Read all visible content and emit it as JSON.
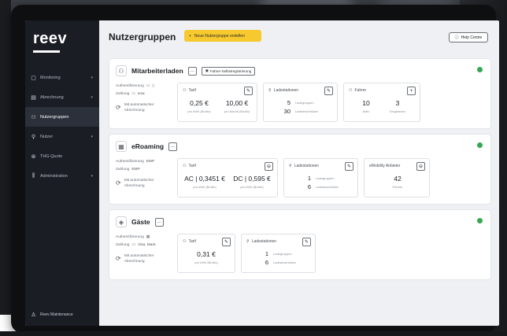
{
  "app": {
    "logo": "reev",
    "page_title": "Nutzergruppen",
    "create_button": "Neue Nutzergruppe erstellen",
    "help_button": "Help Centre"
  },
  "sidebar": {
    "items": [
      {
        "label": "Monitoring",
        "icon": "monitor-icon",
        "has_chevron": true
      },
      {
        "label": "Abrechnung",
        "icon": "billing-icon",
        "has_chevron": true
      },
      {
        "label": "Nutzergruppen",
        "icon": "users-icon",
        "has_chevron": false,
        "active": true
      },
      {
        "label": "Nutzer",
        "icon": "user-icon",
        "has_chevron": true
      },
      {
        "label": "THG Quote",
        "icon": "co2-icon",
        "has_chevron": false
      },
      {
        "label": "Administration",
        "icon": "admin-icon",
        "has_chevron": true
      }
    ],
    "user": "Reev Maintenance"
  },
  "groups": [
    {
      "name": "Mitarbeiterladen",
      "extra_button": "Fahrer-Selbstregistrierung",
      "auth_label": "Authentifizierung",
      "payment_label": "Zahlung",
      "payment_value": "sow.",
      "billing": "Mit automatischer Abrechnung",
      "tariff": {
        "title": "Tarif",
        "values": [
          {
            "v": "0,25 €",
            "l": "pro kWh (Brutto)"
          },
          {
            "v": "10,00 €",
            "l": "pro Monat (Brutto)"
          }
        ]
      },
      "stations": {
        "title": "Ladestationen",
        "rows": [
          {
            "n": "5",
            "l": "Ladegruppen"
          },
          {
            "n": "30",
            "l": "Ladeanschlüsse"
          }
        ]
      },
      "drivers": {
        "title": "Fahrer",
        "values": [
          {
            "v": "10",
            "l": "Aktiv"
          },
          {
            "v": "3",
            "l": "Eingeladen"
          }
        ]
      }
    },
    {
      "name": "eRoaming",
      "auth_label": "Authentifizierung",
      "auth_value": "EMP",
      "payment_label": "Zahlung",
      "payment_value": "EMP",
      "billing": "Mit automatischer Abrechnung",
      "tariff": {
        "title": "Tarif",
        "values": [
          {
            "v": "AC | 0,3451 €",
            "l": "pro kWh (Brutto)"
          },
          {
            "v": "DC | 0,595 €",
            "l": "pro kWh (Brutto)"
          }
        ]
      },
      "stations": {
        "title": "Ladestationen",
        "rows": [
          {
            "n": "1",
            "l": "Ladegruppen"
          },
          {
            "n": "6",
            "l": "Ladeanschlüsse"
          }
        ]
      },
      "provider": {
        "title": "eMobility Anbieter",
        "v": "42",
        "l": "Partner"
      }
    },
    {
      "name": "Gäste",
      "auth_label": "Authentifizierung",
      "payment_label": "Zahlung",
      "payment_value": "Visa, Mast.",
      "billing": "Mit automatischer Abrechnung",
      "tariff": {
        "title": "Tarif",
        "values": [
          {
            "v": "0,31 €",
            "l": "pro kWh (Brutto)"
          }
        ]
      },
      "stations": {
        "title": "Ladestationen",
        "rows": [
          {
            "n": "1",
            "l": "Ladegruppen"
          },
          {
            "n": "6",
            "l": "Ladeanschlüsse"
          }
        ]
      }
    }
  ],
  "colors": {
    "accent": "#f7c92e",
    "status_active": "#35a853",
    "sidebar_bg": "#1a1d24"
  }
}
